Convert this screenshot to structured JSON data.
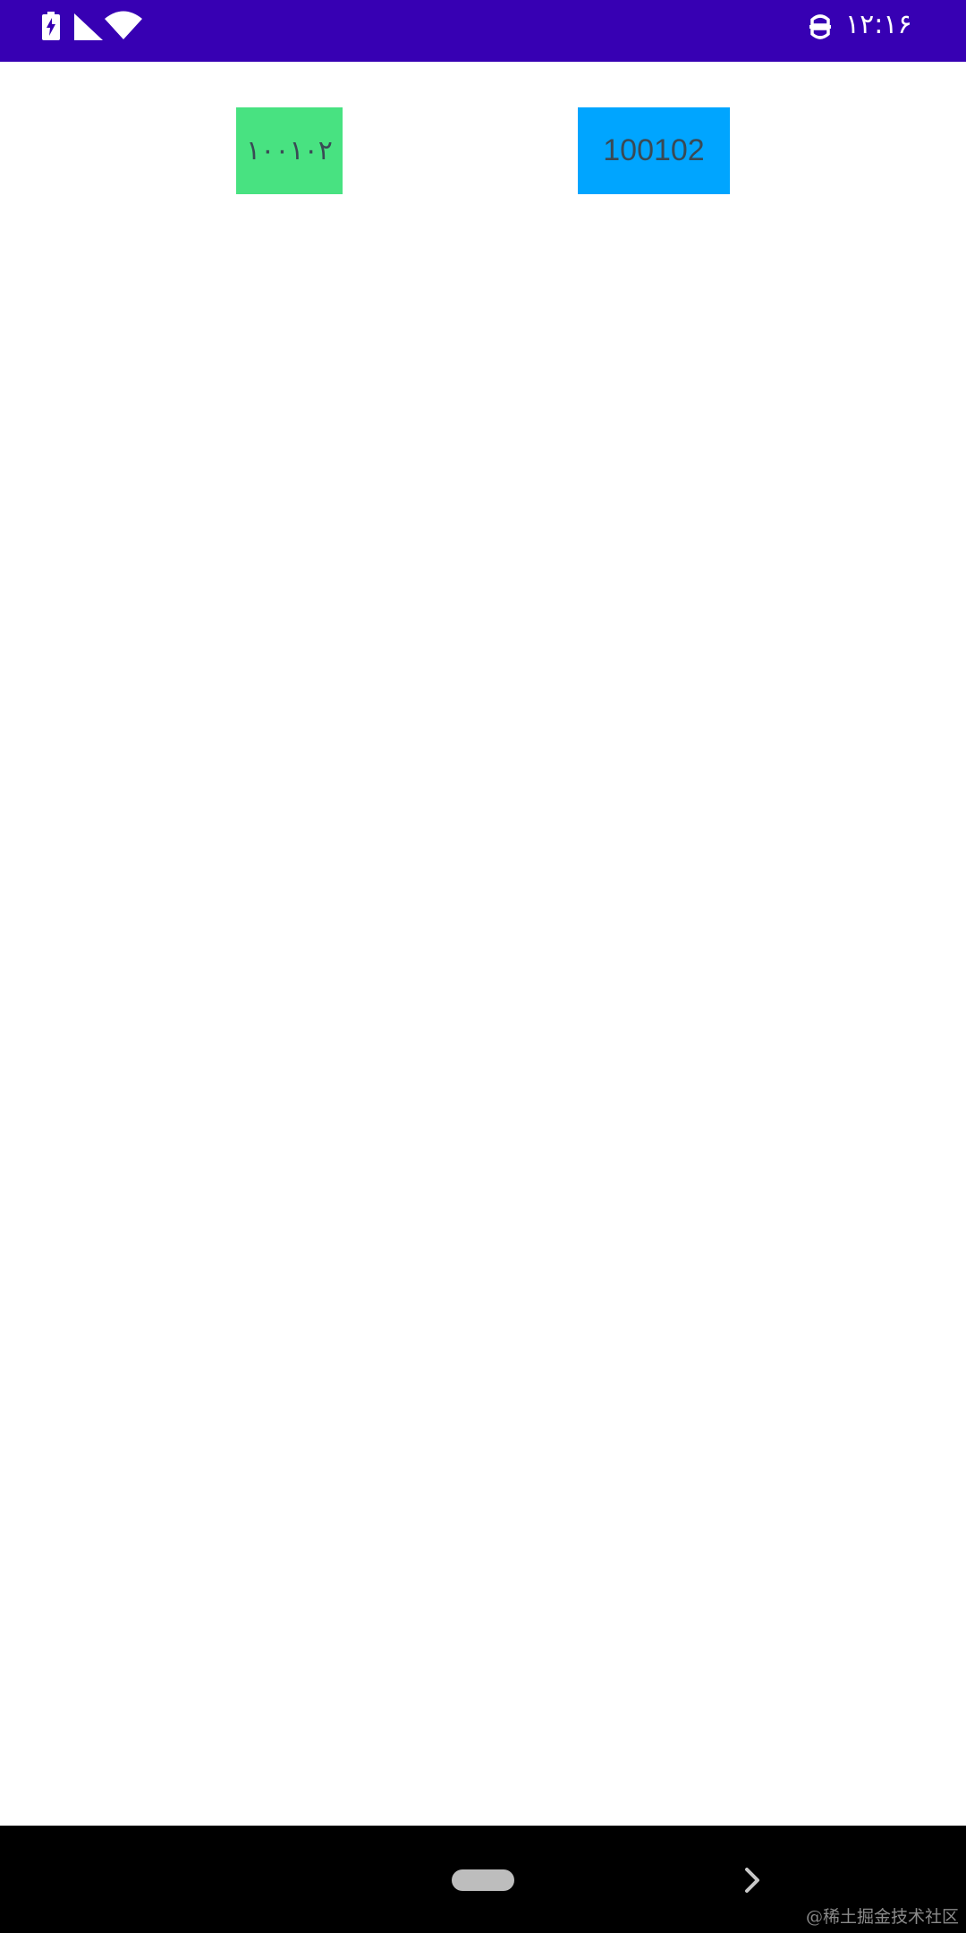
{
  "status_bar": {
    "time": "۱۲:۱۶",
    "background_color": "#3700b3",
    "icons": [
      "battery-charging-icon",
      "cell-signal-icon",
      "wifi-icon",
      "app-notification-icon"
    ]
  },
  "content": {
    "arabic_number_box": {
      "text": "۱۰۰۱۰۲",
      "background_color": "#48e281"
    },
    "latin_number_box": {
      "text": "100102",
      "background_color": "#00a5ff"
    }
  },
  "nav_bar": {
    "icons": [
      "home-pill-icon",
      "back-chevron-icon"
    ],
    "watermark": "@稀土掘金技术社区"
  }
}
